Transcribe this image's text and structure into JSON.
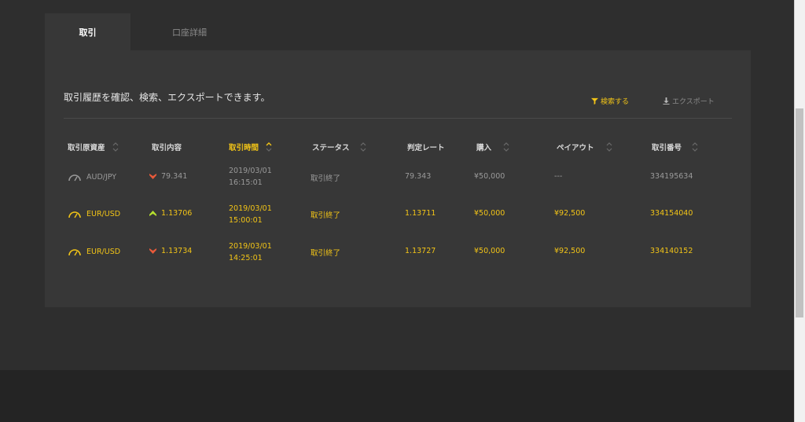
{
  "colors": {
    "accent": "#f2c417",
    "up": "#b6e02e",
    "down": "#ea5a3a",
    "panel": "#373737",
    "page": "#2e2e2e"
  },
  "tabs": [
    {
      "label": "取引",
      "active": true
    },
    {
      "label": "口座詳細",
      "active": false
    }
  ],
  "description": "取引履歴を確認、検索、エクスポートできます。",
  "actions": {
    "search_label": "検索する",
    "export_label": "エクスポート"
  },
  "table": {
    "columns": [
      {
        "label": "取引原資産",
        "sorted": false
      },
      {
        "label": "取引内容",
        "sorted": false
      },
      {
        "label": "取引時間",
        "sorted": true
      },
      {
        "label": "ステータス",
        "sorted": false
      },
      {
        "label": "判定レート",
        "sorted": false
      },
      {
        "label": "購入",
        "sorted": false
      },
      {
        "label": "ペイアウト",
        "sorted": false
      },
      {
        "label": "取引番号",
        "sorted": false
      }
    ],
    "rows": [
      {
        "asset": "AUD/JPY",
        "direction": "down",
        "rate": "79.341",
        "date": "2019/03/01",
        "time": "16:15:01",
        "status": "取引終了",
        "judge_rate": "79.343",
        "purchase": "¥50,000",
        "payout": "---",
        "trade_no": "334195634",
        "highlight": false
      },
      {
        "asset": "EUR/USD",
        "direction": "up",
        "rate": "1.13706",
        "date": "2019/03/01",
        "time": "15:00:01",
        "status": "取引終了",
        "judge_rate": "1.13711",
        "purchase": "¥50,000",
        "payout": "¥92,500",
        "trade_no": "334154040",
        "highlight": true
      },
      {
        "asset": "EUR/USD",
        "direction": "down",
        "rate": "1.13734",
        "date": "2019/03/01",
        "time": "14:25:01",
        "status": "取引終了",
        "judge_rate": "1.13727",
        "purchase": "¥50,000",
        "payout": "¥92,500",
        "trade_no": "334140152",
        "highlight": true
      }
    ]
  }
}
